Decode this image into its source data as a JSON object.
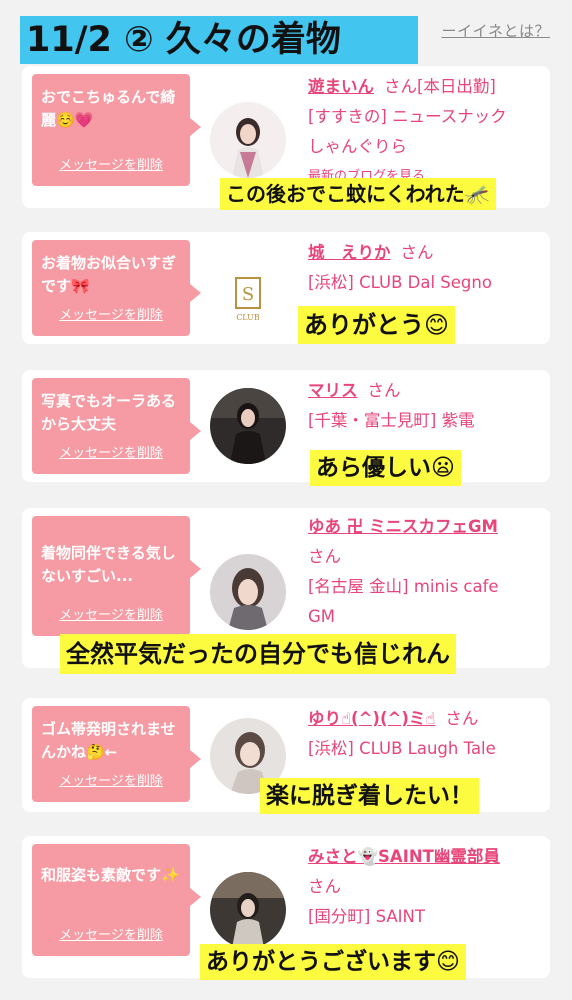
{
  "header": {
    "title": "11/2 ② 久々の着物",
    "top_link": "ーイイネとは？"
  },
  "cards": [
    {
      "message": "おでこちゅるんで綺麗☺️💗",
      "delete_label": "メッセージを削除",
      "name": "遊まいん",
      "honorific": "さん",
      "line1": "[本日出勤]",
      "line2": "[すすきの] ニュースナック",
      "line3": "しゃんぐりら",
      "line4": "最新のブログを見る",
      "caption": "この後おでこ蚊にくわれた🦟"
    },
    {
      "message": "お着物お似合いすぎです🎀",
      "delete_label": "メッセージを削除",
      "name": "城　えりか",
      "honorific": "さん",
      "line2": "[浜松] CLUB Dal Segno",
      "caption": "ありがとう😊"
    },
    {
      "message": "写真でもオーラあるから大丈夫",
      "delete_label": "メッセージを削除",
      "name": "マリス",
      "honorific": "さん",
      "line2": "[千葉・富士見町] 紫電",
      "caption": "あら優しい😦"
    },
    {
      "message": "着物同伴できる気しないすごい...",
      "delete_label": "メッセージを削除",
      "name": "ゆあ 卍 ミニスカフェGM",
      "honorific": "さん",
      "line2": "[名古屋 金山] minis cafe",
      "line3": "GM",
      "caption": "全然平気だったの自分でも信じれん"
    },
    {
      "message": "ゴム帯発明されませんかね🤔←",
      "delete_label": "メッセージを削除",
      "name": "ゆり☝(^)(^)ミ☝",
      "honorific": "さん",
      "line2": "[浜松] CLUB Laugh Tale",
      "caption": "楽に脱ぎ着したい！"
    },
    {
      "message": "和服姿も素敵です✨",
      "delete_label": "メッセージを削除",
      "name": "みさと👻SAINT幽霊部員",
      "honorific": "さん",
      "line2": "[国分町] SAINT",
      "caption": "ありがとうございます😊"
    }
  ],
  "colors": {
    "bubble": "#f69ba3",
    "accent_text": "#e8467a",
    "caption_bg": "#fdfb3f",
    "title_bg": "#42c6f0"
  }
}
